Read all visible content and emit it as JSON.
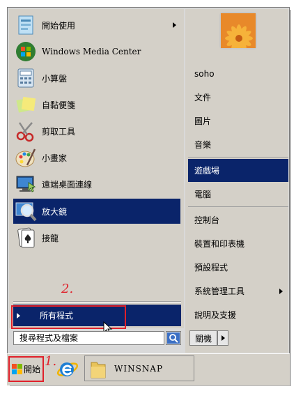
{
  "left_items": [
    {
      "label": "開始使用",
      "icon": "getting-started-icon",
      "has_submenu": true
    },
    {
      "label": "Windows Media Center",
      "icon": "windows-media-center-icon"
    },
    {
      "label": "小算盤",
      "icon": "calculator-icon"
    },
    {
      "label": "自黏便箋",
      "icon": "sticky-notes-icon"
    },
    {
      "label": "剪取工具",
      "icon": "snipping-tool-icon"
    },
    {
      "label": "小畫家",
      "icon": "paint-icon"
    },
    {
      "label": "遠端桌面連線",
      "icon": "remote-desktop-icon"
    },
    {
      "label": "放大鏡",
      "icon": "magnifier-icon",
      "selected": true
    },
    {
      "label": "接龍",
      "icon": "solitaire-icon"
    }
  ],
  "all_programs": {
    "label": "所有程式"
  },
  "search": {
    "value": "搜尋程式及檔案"
  },
  "right_items": [
    {
      "label": "soho"
    },
    {
      "label": "文件"
    },
    {
      "label": "圖片"
    },
    {
      "label": "音樂"
    },
    {
      "label": "遊戲場",
      "selected": true
    },
    {
      "label": "電腦"
    },
    {
      "label": "控制台"
    },
    {
      "label": "裝置和印表機"
    },
    {
      "label": "預設程式"
    },
    {
      "label": "系統管理工具",
      "has_submenu": true
    },
    {
      "label": "說明及支援"
    }
  ],
  "shutdown": {
    "label": "關機"
  },
  "taskbar": {
    "start_label": "開始",
    "window_label": "WINSNAP"
  },
  "annotations": {
    "step1": "1.",
    "step2": "2."
  },
  "colors": {
    "selection": "#0a246a",
    "annotation": "#e0202a"
  }
}
